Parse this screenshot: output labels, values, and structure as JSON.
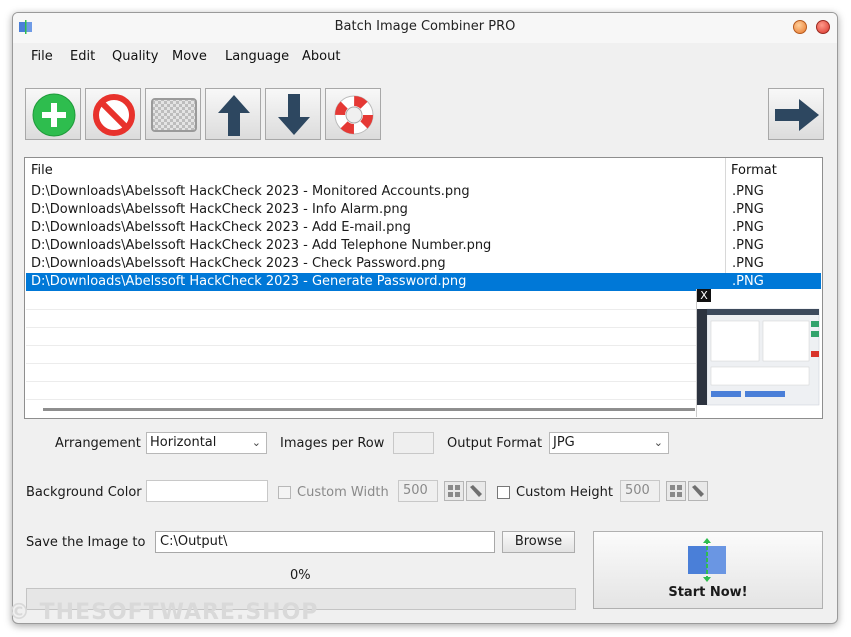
{
  "window": {
    "title": "Batch Image Combiner PRO"
  },
  "menu": [
    "File",
    "Edit",
    "Quality",
    "Move",
    "Language",
    "About"
  ],
  "toolbar": [
    {
      "name": "add-icon",
      "color": "#2ebd4e"
    },
    {
      "name": "remove-icon",
      "color": "#e8322c"
    },
    {
      "name": "clear-icon",
      "color": "#b8b8b8"
    },
    {
      "name": "arrow-up-icon",
      "color": "#2d4760"
    },
    {
      "name": "arrow-down-icon",
      "color": "#2d4760"
    },
    {
      "name": "help-icon",
      "color": "#e53935"
    },
    {
      "name": "arrow-right-icon",
      "color": "#2d4760"
    }
  ],
  "filelist": {
    "columns": [
      "File",
      "Format"
    ],
    "rows": [
      {
        "file": "D:\\Downloads\\Abelssoft HackCheck 2023 - Monitored Accounts.png",
        "format": ".PNG"
      },
      {
        "file": "D:\\Downloads\\Abelssoft HackCheck 2023 - Info Alarm.png",
        "format": ".PNG"
      },
      {
        "file": "D:\\Downloads\\Abelssoft HackCheck 2023 - Add E-mail.png",
        "format": ".PNG"
      },
      {
        "file": "D:\\Downloads\\Abelssoft HackCheck 2023 - Add Telephone Number.png",
        "format": ".PNG"
      },
      {
        "file": "D:\\Downloads\\Abelssoft HackCheck 2023 - Check Password.png",
        "format": ".PNG"
      },
      {
        "file": "D:\\Downloads\\Abelssoft HackCheck 2023 - Generate Password.png",
        "format": ".PNG",
        "selected": true
      }
    ],
    "preview_close": "X"
  },
  "settings": {
    "arrangement_label": "Arrangement",
    "arrangement_value": "Horizontal",
    "images_per_row_label": "Images per Row",
    "output_format_label": "Output Format",
    "output_format_value": "JPG",
    "background_color_label": "Background Color",
    "custom_width_label": "Custom Width",
    "custom_width_value": "500",
    "custom_height_label": "Custom Height",
    "custom_height_value": "500"
  },
  "save": {
    "label": "Save the Image to",
    "path": "C:\\Output\\",
    "browse_label": "Browse"
  },
  "start": {
    "label": "Start Now!"
  },
  "progress": {
    "percent_text": "0%",
    "value": 0
  },
  "watermark": "© THESOFTWARE.SHOP",
  "colors": {
    "selection": "#0078d7",
    "accent_blue": "#4a7fd8",
    "accent_green": "#2ebd4e"
  }
}
